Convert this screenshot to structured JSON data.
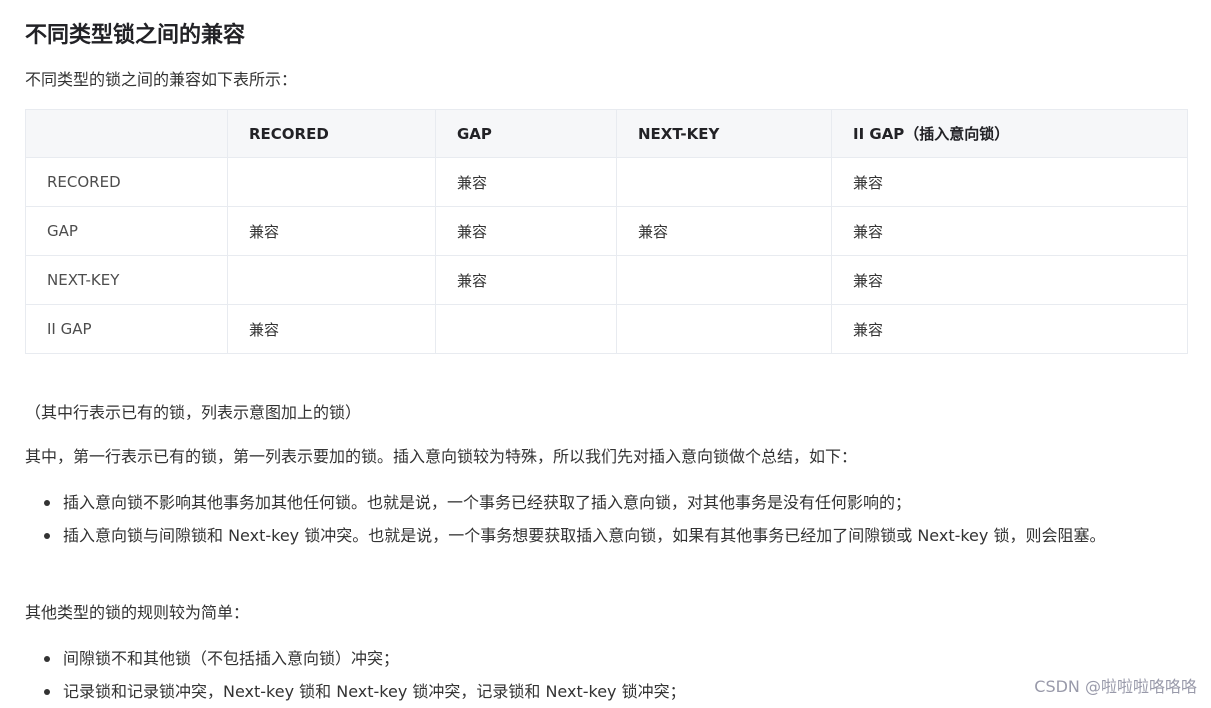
{
  "heading": "不同类型锁之间的兼容",
  "intro": "不同类型的锁之间的兼容如下表所示：",
  "table": {
    "headers": [
      "",
      "RECORED",
      "GAP",
      "NEXT-KEY",
      "II GAP（插入意向锁）"
    ],
    "rows": [
      [
        "RECORED",
        "",
        "兼容",
        "",
        "兼容"
      ],
      [
        "GAP",
        "兼容",
        "兼容",
        "兼容",
        "兼容"
      ],
      [
        "NEXT-KEY",
        "",
        "兼容",
        "",
        "兼容"
      ],
      [
        "II GAP",
        "兼容",
        "",
        "",
        "兼容"
      ]
    ]
  },
  "note": "（其中行表示已有的锁，列表示意图加上的锁）",
  "explain": "其中，第一行表示已有的锁，第一列表示要加的锁。插入意向锁较为特殊，所以我们先对插入意向锁做个总结，如下：",
  "bullets1": [
    "插入意向锁不影响其他事务加其他任何锁。也就是说，一个事务已经获取了插入意向锁，对其他事务是没有任何影响的；",
    "插入意向锁与间隙锁和 Next-key 锁冲突。也就是说，一个事务想要获取插入意向锁，如果有其他事务已经加了间隙锁或 Next-key 锁，则会阻塞。"
  ],
  "other_rules": "其他类型的锁的规则较为简单：",
  "bullets2": [
    "间隙锁不和其他锁（不包括插入意向锁）冲突；",
    "记录锁和记录锁冲突，Next-key 锁和 Next-key 锁冲突，记录锁和 Next-key 锁冲突；"
  ],
  "watermark": "CSDN @啦啦啦咯咯咯"
}
